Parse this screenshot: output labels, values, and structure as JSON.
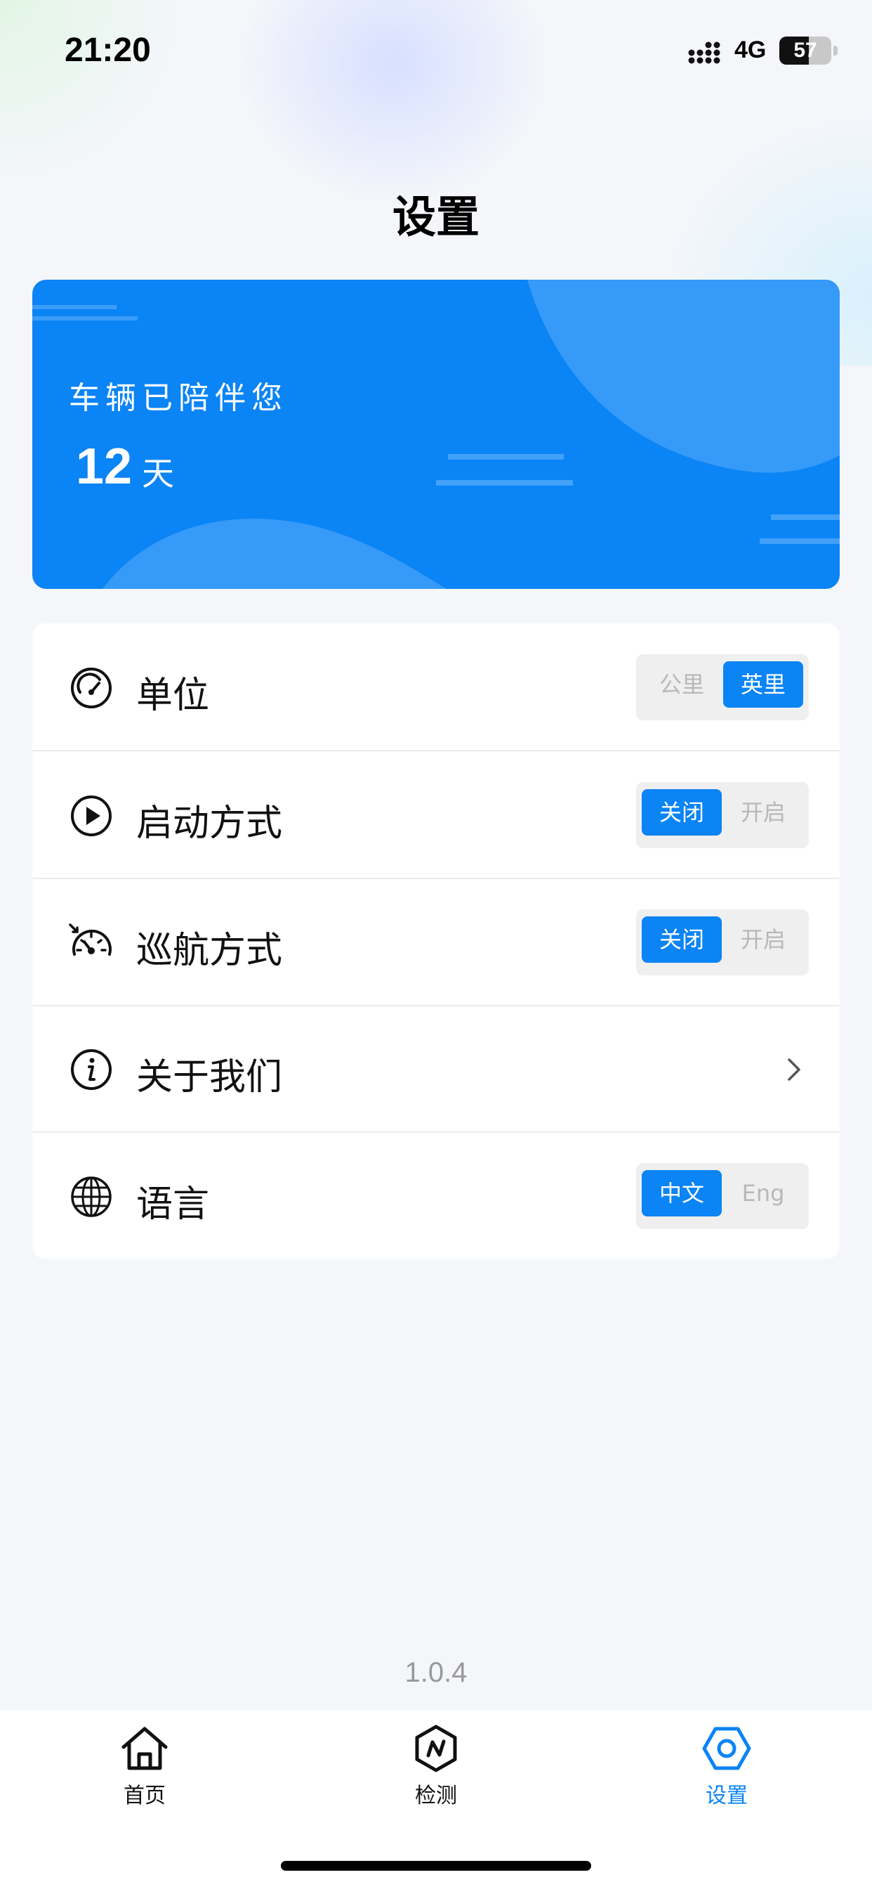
{
  "status_bar": {
    "time": "21:20",
    "network": "4G",
    "battery": "57",
    "battery_level": 0.57,
    "icons": [
      "signal-icon",
      "battery-icon"
    ]
  },
  "page": {
    "title": "设置"
  },
  "banner": {
    "label": "车辆已陪伴您",
    "days": "12",
    "unit": "天"
  },
  "settings": {
    "unit": {
      "icon": "speedometer-icon",
      "label": "单位",
      "options": [
        "公里",
        "英里"
      ],
      "selected": "英里"
    },
    "startup": {
      "icon": "play-icon",
      "label": "启动方式",
      "options": [
        "关闭",
        "开启"
      ],
      "selected": "关闭"
    },
    "cruise": {
      "icon": "cruise-gauge-icon",
      "label": "巡航方式",
      "options": [
        "关闭",
        "开启"
      ],
      "selected": "关闭"
    },
    "about": {
      "icon": "info-icon",
      "label": "关于我们"
    },
    "language": {
      "icon": "globe-icon",
      "label": "语言",
      "options": [
        "中文",
        "Eng"
      ],
      "selected": "中文"
    }
  },
  "version": "1.0.4",
  "tab_bar": {
    "tabs": [
      {
        "icon": "home-icon",
        "label": "首页"
      },
      {
        "icon": "detect-icon",
        "label": "检测"
      },
      {
        "icon": "settings-icon",
        "label": "设置"
      }
    ],
    "active": "设置"
  },
  "colors": {
    "accent": "#0b84f5",
    "background": "#f4f6fa",
    "inactive_text": "#b8b8b8",
    "version_text": "#999999"
  }
}
